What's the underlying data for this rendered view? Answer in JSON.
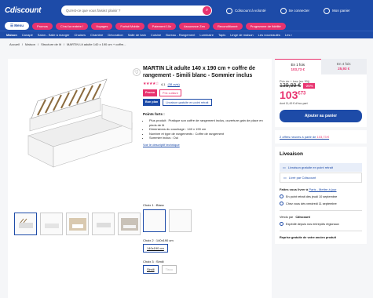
{
  "header": {
    "logo": "Cdiscount",
    "search_placeholder": "Qu'est-ce que vous faisiez plaisir ?",
    "links": [
      "Cdiscount à volonté",
      "Se connecter",
      "Mon panier"
    ]
  },
  "nav1": {
    "menu": "Menu",
    "items": [
      "Promos",
      "C'est la rentrée !",
      "Voyages",
      "Forfait Mobile",
      "Paiement 10x",
      "Assurance Zen",
      "Reconditionné",
      "Programme de fidélité"
    ]
  },
  "nav2": {
    "home": "Maison",
    "items": [
      "Canapé",
      "Salon - Salle à manger",
      "Chaises",
      "Chambre",
      "Décoration",
      "Salle de bain",
      "Cuisine",
      "Bureau - Rangement",
      "Luminaire",
      "Tapis",
      "Linge de maison",
      "Les nouveautés",
      "Les r"
    ]
  },
  "breadcrumb": [
    "Accueil",
    "Maison",
    "Structure de lit",
    "MARTIN Lit adulte 140 x 190 cm + coffre..."
  ],
  "product": {
    "title": "MARTIN Lit adulte 140 x 190 cm + coffre de rangement - Simili blanc - Sommier inclus",
    "rating": "4,1",
    "reviews": "(38 avis)",
    "badges": [
      "Promo",
      "Prix cutilant"
    ],
    "badges2": [
      "Bon plan",
      "Livraison gratuite en point retrait"
    ],
    "features_title": "Points forts :",
    "features": [
      "Plus produit : Pratique son coffre de rangement inclus, ouverture gain de place en pieds de lit",
      "Dimensions du couchage : 140 x 190 cm",
      "Nombre et type de rangements : Coffre de rangement",
      "Sommier inclus : Oui"
    ],
    "more": "Voir le descriptif technique"
  },
  "choices": {
    "c1_label": "Choix 1 : Blanc",
    "c2_label": "Choix 2 : 140x190 cm",
    "c2_opt": "140x190 cm",
    "c3_label": "Choix 3 : Simili",
    "c3_opts": [
      "Simili",
      "Tissu"
    ]
  },
  "buy": {
    "tab1": "En 1 fois",
    "tab1_price": "103,73 €",
    "tab2": "En 4 fois",
    "tab2_price": "25,93 €",
    "old_label": "Prix de + bas (en 30j)",
    "old_price": "139,99 €",
    "discount": "-25%",
    "price": "103",
    "cents": "€73",
    "eco": "dont 11,49 € d'éco-part",
    "add": "Ajouter au panier"
  },
  "offers": {
    "text": "2 offres neuves à partir de",
    "price": "103,73 €"
  },
  "delivery": {
    "title": "Liveaison",
    "opt1": "Livraison gratuite en point retrait",
    "opt2": "Livré par Cdiscount",
    "where": "Faites vous livrer à",
    "city": "Paris - Mettre à jour",
    "d1": "En point retrait dès jeudi 10 septembre",
    "d2": "Chez vous dès vendredi 11 septembre",
    "seller_label": "Vendu par",
    "seller": "Cdiscount",
    "ship": "Expédié depuis nos entrepôts régionaux",
    "reprise": "Reprise gratuite de votre ancien produit"
  },
  "colors": {
    "brand": "#1d4ba8",
    "accent": "#e8336f"
  }
}
